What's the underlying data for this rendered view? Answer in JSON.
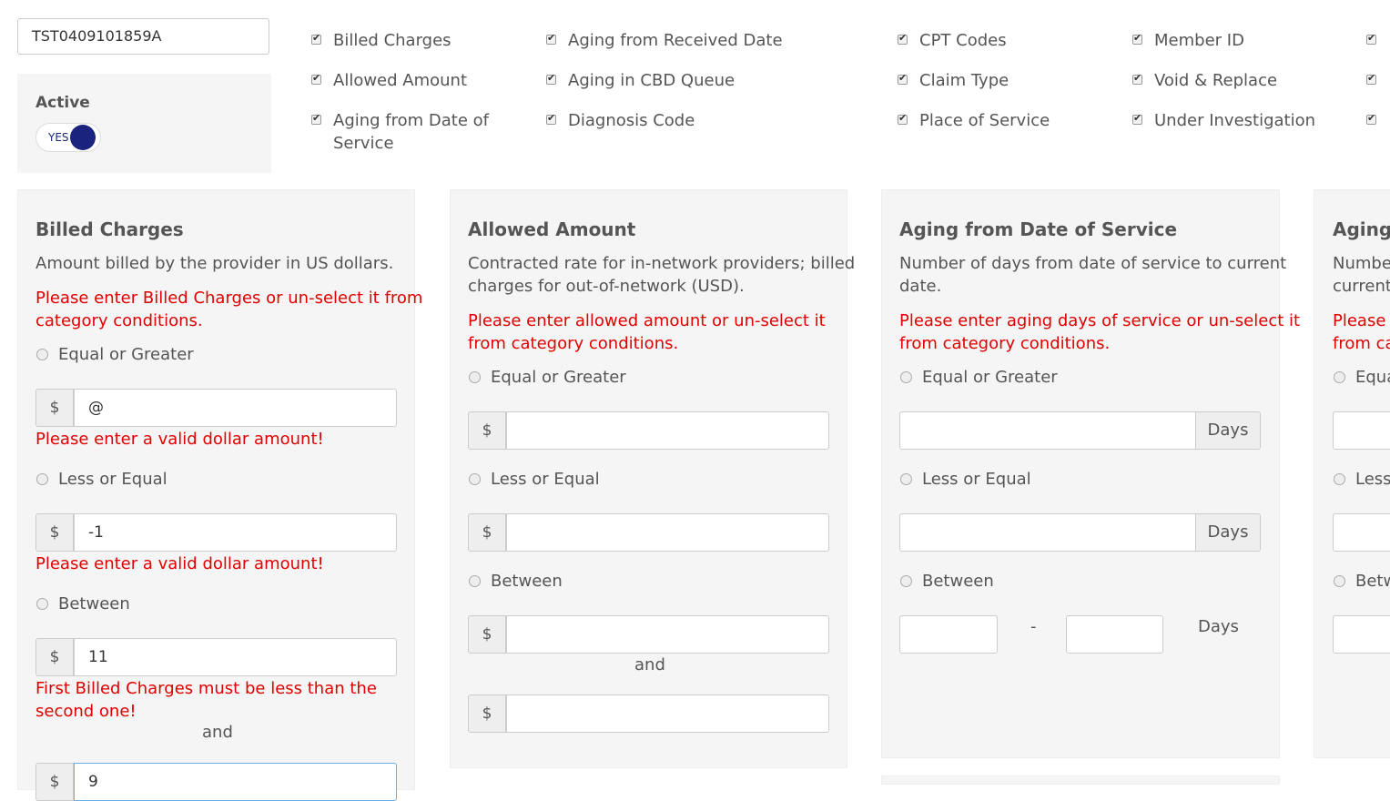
{
  "claim_id": "TST0409101859A",
  "active": {
    "label": "Active",
    "toggle_text": "YES"
  },
  "checkboxes": [
    [
      "Billed Charges",
      "Allowed Amount",
      "Aging from Date of",
      "Service"
    ],
    [
      "Aging from Received Date",
      "Aging in CBD Queue",
      "Diagnosis Code"
    ],
    [
      "CPT Codes",
      "Claim Type",
      "Place of Service"
    ],
    [
      "Member ID",
      "Void & Replace",
      "Under Investigation"
    ]
  ],
  "panels": {
    "billed": {
      "title": "Billed Charges",
      "desc": "Amount billed by the provider in US dollars.",
      "error_1": "Please enter Billed Charges or un-select it from",
      "error_2": "category conditions.",
      "opt_ge": "Equal or Greater",
      "opt_le": "Less or Equal",
      "opt_between": "Between",
      "currency": "$",
      "ge_value": "@",
      "le_value": "-1",
      "between_from": "11",
      "between_to": "9",
      "invalid_amount": "Please enter a valid dollar amount!",
      "between_error_1": "First Billed Charges must be less than the",
      "between_error_2": "second one!",
      "and": "and"
    },
    "allowed": {
      "title": "Allowed Amount",
      "desc_1": "Contracted rate for in-network providers; billed",
      "desc_2": "charges for out-of-network (USD).",
      "error_1": "Please enter allowed amount or un-select it",
      "error_2": "from category conditions.",
      "opt_ge": "Equal or Greater",
      "opt_le": "Less or Equal",
      "opt_between": "Between",
      "currency": "$",
      "and": "and"
    },
    "aging_dos": {
      "title": "Aging from Date of Service",
      "desc_1": "Number of days from date of service to current",
      "desc_2": "date.",
      "error_1": "Please enter aging days of service or un-select it",
      "error_2": "from category conditions.",
      "opt_ge": "Equal or Greater",
      "opt_le": "Less or Equal",
      "opt_between": "Between",
      "days": "Days",
      "dash": "-"
    },
    "aging_partial": {
      "title": "Aging",
      "desc_1": "Numbe",
      "desc_2": "current",
      "error_1": "Please e",
      "error_2": "from ca",
      "opt_ge": "Equa",
      "opt_le": "Less",
      "opt_between": "Betw"
    }
  },
  "colors": {
    "error": "#e00000",
    "toggle": "#1a237e",
    "panel_bg": "#f5f5f5"
  }
}
